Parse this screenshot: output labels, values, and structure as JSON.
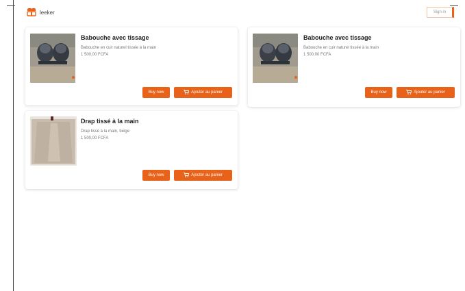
{
  "header": {
    "brand": "leeker",
    "right_button": "Sign in"
  },
  "colors": {
    "accent": "#e8621a",
    "card_bg": "#ffffff"
  },
  "icons": [
    "logo-icon",
    "cart-icon"
  ],
  "cards": [
    {
      "title": "Babouche avec tissage",
      "description": "Babouche en cuir naturel tissée à la main",
      "price": "1 500,00 FCFA",
      "buy_label": "Buy now",
      "cart_label": "Ajouter au panier"
    },
    {
      "title": "Babouche avec tissage",
      "description": "Babouche en cuir naturel tissée à la main",
      "price": "1 500,00 FCFA",
      "buy_label": "Buy now",
      "cart_label": "Ajouter au panier"
    },
    {
      "title": "Drap tissé à la main",
      "description": "Drap tissé à la main, beige",
      "price": "1 500,00 FCFA",
      "buy_label": "Buy now",
      "cart_label": "Ajouter au panier"
    }
  ]
}
